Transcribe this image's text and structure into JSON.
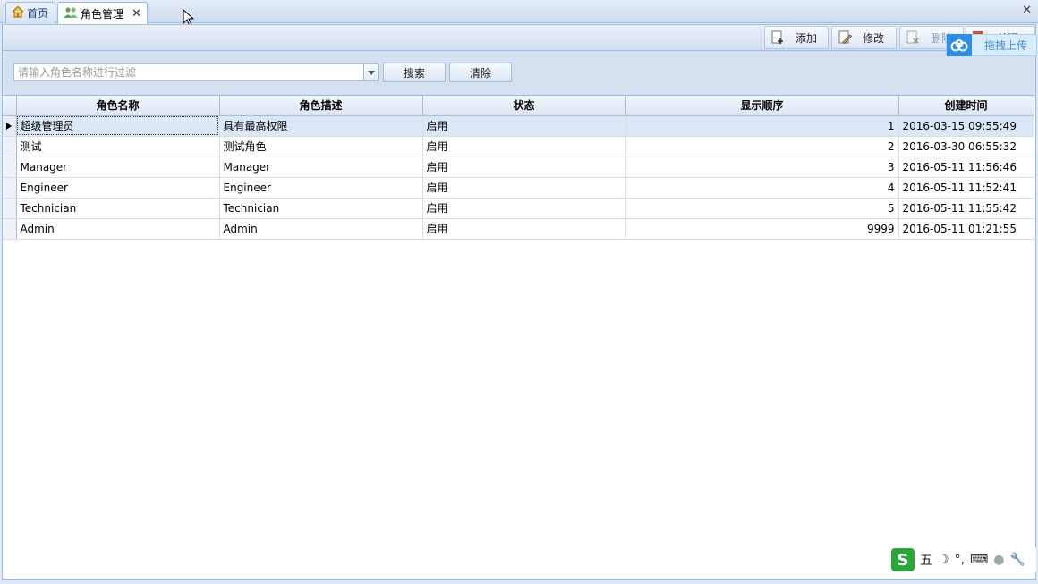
{
  "tabs": [
    {
      "label": "首页"
    },
    {
      "label": "角色管理"
    }
  ],
  "toolbar": {
    "add": "添加",
    "edit": "修改",
    "delete": "删除",
    "close": "关闭"
  },
  "baidu_upload": "拖拽上传",
  "filter": {
    "placeholder": "请输入角色名称进行过滤",
    "search": "搜索",
    "clear": "清除"
  },
  "grid": {
    "columns": [
      "角色名称",
      "角色描述",
      "状态",
      "显示顺序",
      "创建时间"
    ],
    "rows": [
      {
        "name": "超级管理员",
        "desc": "具有最高权限",
        "status": "启用",
        "order": "1",
        "created": "2016-03-15 09:55:49"
      },
      {
        "name": "测试",
        "desc": "测试角色",
        "status": "启用",
        "order": "2",
        "created": "2016-03-30 06:55:32"
      },
      {
        "name": "Manager",
        "desc": "Manager",
        "status": "启用",
        "order": "3",
        "created": "2016-05-11 11:56:46"
      },
      {
        "name": "Engineer",
        "desc": "Engineer",
        "status": "启用",
        "order": "4",
        "created": "2016-05-11 11:52:41"
      },
      {
        "name": "Technician",
        "desc": "Technician",
        "status": "启用",
        "order": "5",
        "created": "2016-05-11 11:55:42"
      },
      {
        "name": "Admin",
        "desc": "Admin",
        "status": "启用",
        "order": "9999",
        "created": "2016-05-11 01:21:55"
      }
    ]
  },
  "ime": {
    "logo": "S",
    "mode": "五"
  },
  "colors": {
    "border": "#99bbe8",
    "selected_row": "#dbe6f6",
    "ime_green": "#2aa63b",
    "baidu_blue": "#2e8de6"
  }
}
